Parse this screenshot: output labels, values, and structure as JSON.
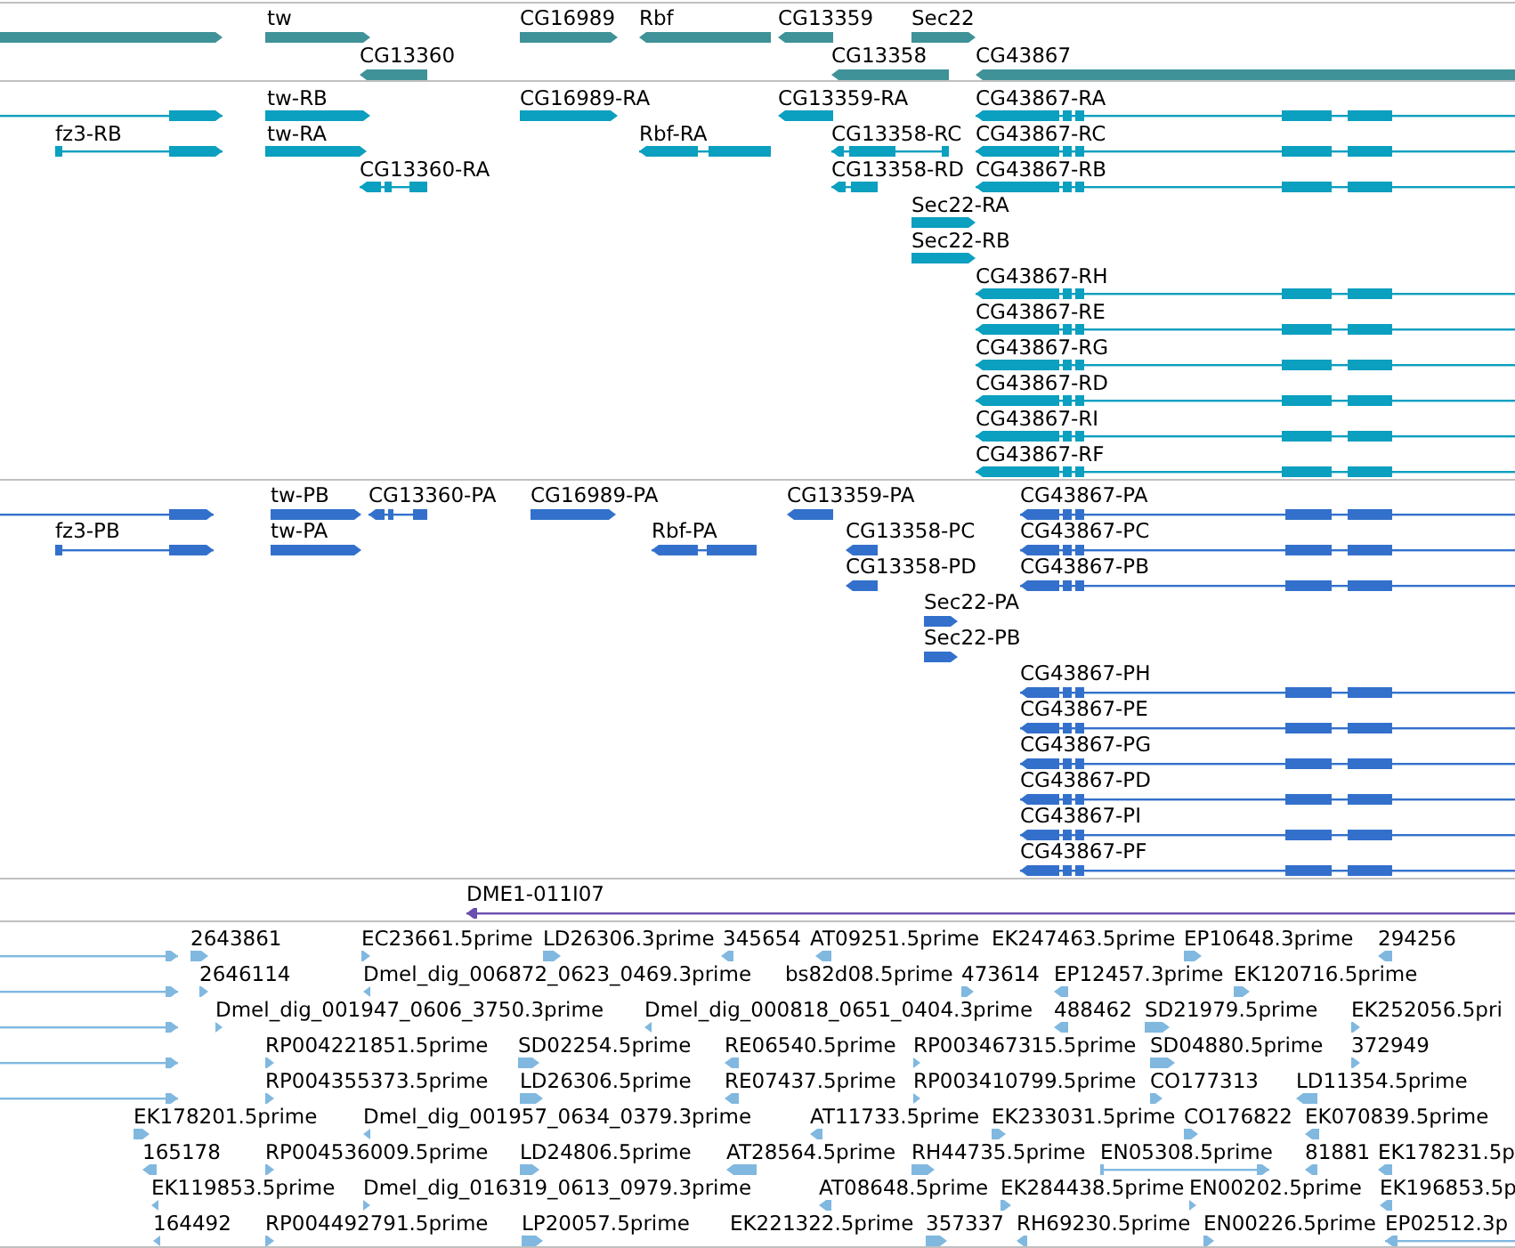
{
  "tracks": [
    {
      "kind": "gene",
      "rows": [
        {
          "features": [
            {
              "reverse": false
            },
            {
              "label": "tw",
              "reverse": false
            },
            {
              "label": "CG16989",
              "reverse": false
            },
            {
              "label": "Rbf",
              "reverse": true
            },
            {
              "label": "CG13359",
              "reverse": true
            },
            {
              "label": "Sec22",
              "reverse": false
            }
          ]
        },
        {
          "features": [
            {
              "label": "CG13360",
              "reverse": true
            },
            {
              "label": "CG13358",
              "reverse": true
            },
            {
              "label": "CG43867",
              "reverse": true
            }
          ]
        }
      ]
    },
    {
      "kind": "transcript",
      "rows": [
        {
          "features": [
            {
              "reverse": false
            },
            {
              "label": "tw-RB",
              "reverse": false
            },
            {
              "label": "CG16989-RA",
              "reverse": false
            },
            {
              "label": "CG13359-RA",
              "reverse": true
            },
            {
              "label": "CG43867-RA",
              "reverse": true
            }
          ]
        },
        {
          "features": [
            {
              "label": "fz3-RB",
              "reverse": false
            },
            {
              "label": "tw-RA",
              "reverse": false
            },
            {
              "label": "Rbf-RA",
              "reverse": true
            },
            {
              "label": "CG13358-RC",
              "reverse": true
            },
            {
              "label": "CG43867-RC",
              "reverse": true
            }
          ]
        },
        {
          "features": [
            {
              "label": "CG13360-RA",
              "reverse": true
            },
            {
              "label": "CG13358-RD",
              "reverse": true
            },
            {
              "label": "CG43867-RB",
              "reverse": true
            }
          ]
        },
        {
          "features": [
            {
              "label": "Sec22-RA",
              "reverse": false
            }
          ]
        },
        {
          "features": [
            {
              "label": "Sec22-RB",
              "reverse": false
            }
          ]
        },
        {
          "features": [
            {
              "label": "CG43867-RH",
              "reverse": true
            }
          ]
        },
        {
          "features": [
            {
              "label": "CG43867-RE",
              "reverse": true
            }
          ]
        },
        {
          "features": [
            {
              "label": "CG43867-RG",
              "reverse": true
            }
          ]
        },
        {
          "features": [
            {
              "label": "CG43867-RD",
              "reverse": true
            }
          ]
        },
        {
          "features": [
            {
              "label": "CG43867-RI",
              "reverse": true
            }
          ]
        },
        {
          "features": [
            {
              "label": "CG43867-RF",
              "reverse": true
            }
          ]
        }
      ]
    },
    {
      "kind": "polypeptide",
      "rows": [
        {
          "features": [
            {
              "reverse": false
            },
            {
              "label": "tw-PB",
              "reverse": false
            },
            {
              "label": "CG13360-PA",
              "reverse": true
            },
            {
              "label": "CG16989-PA",
              "reverse": false
            },
            {
              "label": "CG13359-PA",
              "reverse": true
            },
            {
              "label": "CG43867-PA",
              "reverse": true
            }
          ]
        },
        {
          "features": [
            {
              "label": "fz3-PB",
              "reverse": false
            },
            {
              "label": "tw-PA",
              "reverse": false
            },
            {
              "label": "Rbf-PA",
              "reverse": true
            },
            {
              "label": "CG13358-PC",
              "reverse": true
            },
            {
              "label": "CG43867-PC",
              "reverse": true
            }
          ]
        },
        {
          "features": [
            {
              "label": "CG13358-PD",
              "reverse": true
            },
            {
              "label": "CG43867-PB",
              "reverse": true
            }
          ]
        },
        {
          "features": [
            {
              "label": "Sec22-PA",
              "reverse": false
            }
          ]
        },
        {
          "features": [
            {
              "label": "Sec22-PB",
              "reverse": false
            }
          ]
        },
        {
          "features": [
            {
              "label": "CG43867-PH",
              "reverse": true
            }
          ]
        },
        {
          "features": [
            {
              "label": "CG43867-PE",
              "reverse": true
            }
          ]
        },
        {
          "features": [
            {
              "label": "CG43867-PG",
              "reverse": true
            }
          ]
        },
        {
          "features": [
            {
              "label": "CG43867-PD",
              "reverse": true
            }
          ]
        },
        {
          "features": [
            {
              "label": "CG43867-PI",
              "reverse": true
            }
          ]
        },
        {
          "features": [
            {
              "label": "CG43867-PF",
              "reverse": true
            }
          ]
        }
      ]
    },
    {
      "kind": "clone",
      "rows": [
        {
          "features": [
            {
              "label": "DME1-011I07",
              "reverse": true
            }
          ]
        }
      ]
    },
    {
      "kind": "est",
      "rows": [
        {
          "features": [
            {
              "reverse": false
            },
            {
              "label": "2643861",
              "reverse": false
            },
            {
              "label": "EC23661.5prime",
              "reverse": false
            },
            {
              "label": "LD26306.3prime",
              "reverse": false
            },
            {
              "label": "345654",
              "reverse": true
            },
            {
              "label": "AT09251.5prime",
              "reverse": true
            },
            {
              "label": "EK247463.5prime"
            },
            {
              "label": "EP10648.3prime",
              "reverse": false
            },
            {
              "label": "294256",
              "reverse": true
            }
          ]
        },
        {
          "features": [
            {
              "reverse": false
            },
            {
              "label": "2646114",
              "reverse": false
            },
            {
              "label": "Dmel_dig_006872_0623_0469.3prime",
              "reverse": true
            },
            {
              "label": "bs82d08.5prime"
            },
            {
              "label": "473614",
              "reverse": false
            },
            {
              "label": "EP12457.3prime",
              "reverse": true
            },
            {
              "label": "EK120716.5prime",
              "reverse": false
            }
          ]
        },
        {
          "features": [
            {
              "reverse": false
            },
            {
              "label": "Dmel_dig_001947_0606_3750.3prime",
              "reverse": false
            },
            {
              "label": "Dmel_dig_000818_0651_0404.3prime",
              "reverse": true
            },
            {
              "label": "488462",
              "reverse": true
            },
            {
              "label": "SD21979.5prime",
              "reverse": false
            },
            {
              "label": "EK252056.5pri",
              "reverse": false
            }
          ]
        },
        {
          "features": [
            {
              "reverse": false
            },
            {
              "label": "RP004221851.5prime",
              "reverse": false
            },
            {
              "label": "SD02254.5prime",
              "reverse": false
            },
            {
              "label": "RE06540.5prime",
              "reverse": true
            },
            {
              "label": "RP003467315.5prime",
              "reverse": false
            },
            {
              "label": "SD04880.5prime",
              "reverse": false
            },
            {
              "label": "372949",
              "reverse": false
            }
          ]
        },
        {
          "features": [
            {
              "reverse": false
            },
            {
              "label": "RP004355373.5prime",
              "reverse": false
            },
            {
              "label": "LD26306.5prime",
              "reverse": false
            },
            {
              "label": "RE07437.5prime",
              "reverse": true
            },
            {
              "label": "RP003410799.5prime",
              "reverse": false
            },
            {
              "label": "CO177313",
              "reverse": false
            },
            {
              "label": "LD11354.5prime",
              "reverse": true
            }
          ]
        },
        {
          "features": [
            {
              "label": "EK178201.5prime",
              "reverse": false
            },
            {
              "label": "Dmel_dig_001957_0634_0379.3prime",
              "reverse": true
            },
            {
              "label": "AT11733.5prime",
              "reverse": true
            },
            {
              "label": "EK233031.5prime",
              "reverse": false
            },
            {
              "label": "CO176822",
              "reverse": false
            },
            {
              "label": "EK070839.5prime",
              "reverse": true
            }
          ]
        },
        {
          "features": [
            {
              "label": "165178",
              "reverse": true
            },
            {
              "label": "RP004536009.5prime",
              "reverse": false
            },
            {
              "label": "LD24806.5prime",
              "reverse": false
            },
            {
              "label": "AT28564.5prime",
              "reverse": true
            },
            {
              "label": "RH44735.5prime",
              "reverse": false
            },
            {
              "label": "EN05308.5prime",
              "reverse": false
            },
            {
              "label": "81881",
              "reverse": true
            },
            {
              "label": "EK178231.5p",
              "reverse": true
            }
          ]
        },
        {
          "features": [
            {
              "label": "EK119853.5prime",
              "reverse": true
            },
            {
              "label": "Dmel_dig_016319_0613_0979.3prime",
              "reverse": false
            },
            {
              "label": "AT08648.5prime",
              "reverse": true
            },
            {
              "label": "EK284438.5prime",
              "reverse": false
            },
            {
              "label": "EN00202.5prime",
              "reverse": false
            },
            {
              "label": "EK196853.5p",
              "reverse": true
            }
          ]
        },
        {
          "features": [
            {
              "label": "164492",
              "reverse": true
            },
            {
              "label": "RP004492791.5prime",
              "reverse": false
            },
            {
              "label": "LP20057.5prime",
              "reverse": false
            },
            {
              "label": "EK221322.5prime"
            },
            {
              "label": "357337",
              "reverse": false
            },
            {
              "label": "RH69230.5prime",
              "reverse": true
            },
            {
              "label": "EN00226.5prime",
              "reverse": false
            },
            {
              "label": "EP02512.3p",
              "reverse": true
            }
          ]
        }
      ]
    }
  ]
}
